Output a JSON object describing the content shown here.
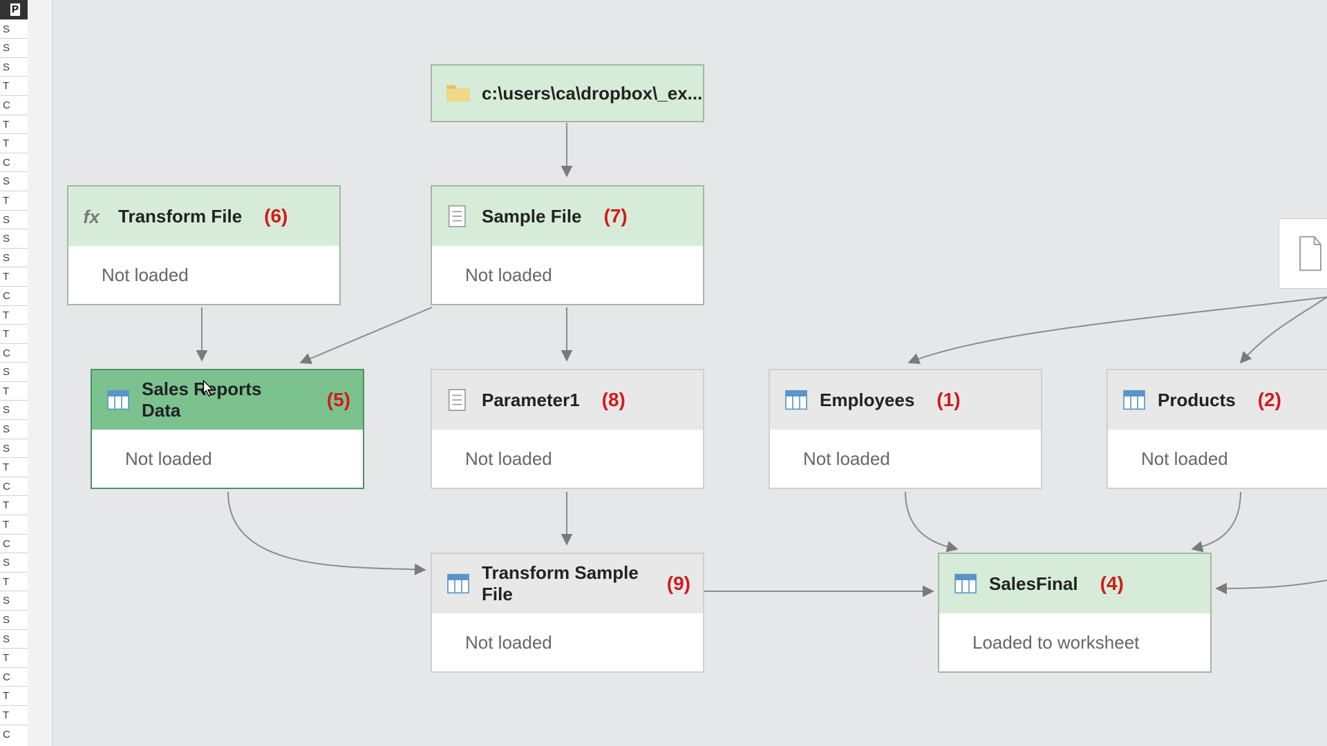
{
  "row_headers": {
    "top": "P",
    "items": [
      "S",
      "S",
      "S",
      "T",
      "C",
      "T",
      "T",
      "C",
      "S",
      "T",
      "S",
      "S",
      "S",
      "T",
      "C",
      "T",
      "T",
      "C",
      "S",
      "T",
      "S",
      "S",
      "S",
      "T",
      "C",
      "T",
      "T",
      "C",
      "S",
      "T",
      "S",
      "S",
      "S",
      "T",
      "C",
      "T",
      "T",
      "C"
    ]
  },
  "nodes": {
    "source": {
      "title": "c:\\users\\ca\\dropbox\\_ex...",
      "status": ""
    },
    "transform_file": {
      "title": "Transform File",
      "status": "Not loaded",
      "annot": "(6)"
    },
    "sample_file": {
      "title": "Sample File",
      "status": "Not loaded",
      "annot": "(7)"
    },
    "sales_reports": {
      "title": "Sales Reports Data",
      "status": "Not loaded",
      "annot": "(5)"
    },
    "parameter1": {
      "title": "Parameter1",
      "status": "Not loaded",
      "annot": "(8)"
    },
    "employees": {
      "title": "Employees",
      "status": "Not loaded",
      "annot": "(1)"
    },
    "products": {
      "title": "Products",
      "status": "Not loaded",
      "annot": "(2)"
    },
    "transform_sample_file": {
      "title": "Transform Sample File",
      "status": "Not loaded",
      "annot": "(9)"
    },
    "sales_final": {
      "title": "SalesFinal",
      "status": "Loaded to worksheet",
      "annot": "(4)"
    }
  }
}
